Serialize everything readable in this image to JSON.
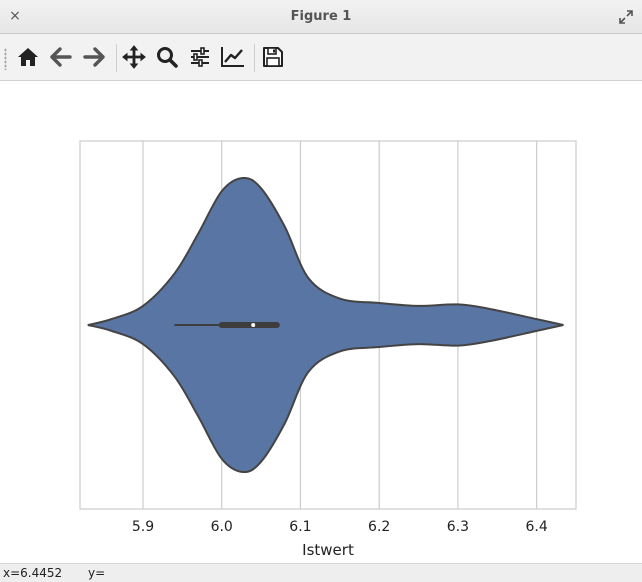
{
  "window": {
    "title": "Figure 1",
    "close_glyph": "×"
  },
  "toolbar": {
    "buttons": [
      {
        "name": "home-button",
        "icon": "home-icon"
      },
      {
        "name": "back-button",
        "icon": "arrow-left-icon"
      },
      {
        "name": "forward-button",
        "icon": "arrow-right-icon"
      },
      {
        "name": "pan-button",
        "icon": "move-icon"
      },
      {
        "name": "zoom-button",
        "icon": "magnifier-icon"
      },
      {
        "name": "configure-subplots-button",
        "icon": "sliders-icon"
      },
      {
        "name": "edit-axis-button",
        "icon": "line-chart-icon"
      },
      {
        "name": "save-button",
        "icon": "floppy-disk-icon"
      }
    ]
  },
  "status": {
    "x": "x=6.4452",
    "y": "y="
  },
  "chart_data": {
    "type": "violin",
    "orientation": "horizontal",
    "xlabel": "Istwert",
    "ylabel": "",
    "xlim": [
      5.82,
      6.45
    ],
    "xticks": [
      "5.9",
      "6.0",
      "6.1",
      "6.2",
      "6.3",
      "6.4"
    ],
    "grid": "vertical",
    "color": "#5975a4",
    "edge_color": "#444444",
    "density_profile": [
      {
        "x": 5.83,
        "w": 0.0
      },
      {
        "x": 5.86,
        "w": 0.04
      },
      {
        "x": 5.9,
        "w": 0.13
      },
      {
        "x": 5.94,
        "w": 0.35
      },
      {
        "x": 5.97,
        "w": 0.62
      },
      {
        "x": 6.0,
        "w": 0.91
      },
      {
        "x": 6.027,
        "w": 1.0
      },
      {
        "x": 6.05,
        "w": 0.93
      },
      {
        "x": 6.08,
        "w": 0.67
      },
      {
        "x": 6.11,
        "w": 0.32
      },
      {
        "x": 6.15,
        "w": 0.18
      },
      {
        "x": 6.2,
        "w": 0.15
      },
      {
        "x": 6.25,
        "w": 0.13
      },
      {
        "x": 6.3,
        "w": 0.14
      },
      {
        "x": 6.34,
        "w": 0.11
      },
      {
        "x": 6.4,
        "w": 0.04
      },
      {
        "x": 6.434,
        "w": 0.0
      }
    ],
    "box": {
      "whisker_low": 5.94,
      "q1": 6.0,
      "median": 6.04,
      "q3": 6.07,
      "whisker_high": 6.07
    }
  }
}
